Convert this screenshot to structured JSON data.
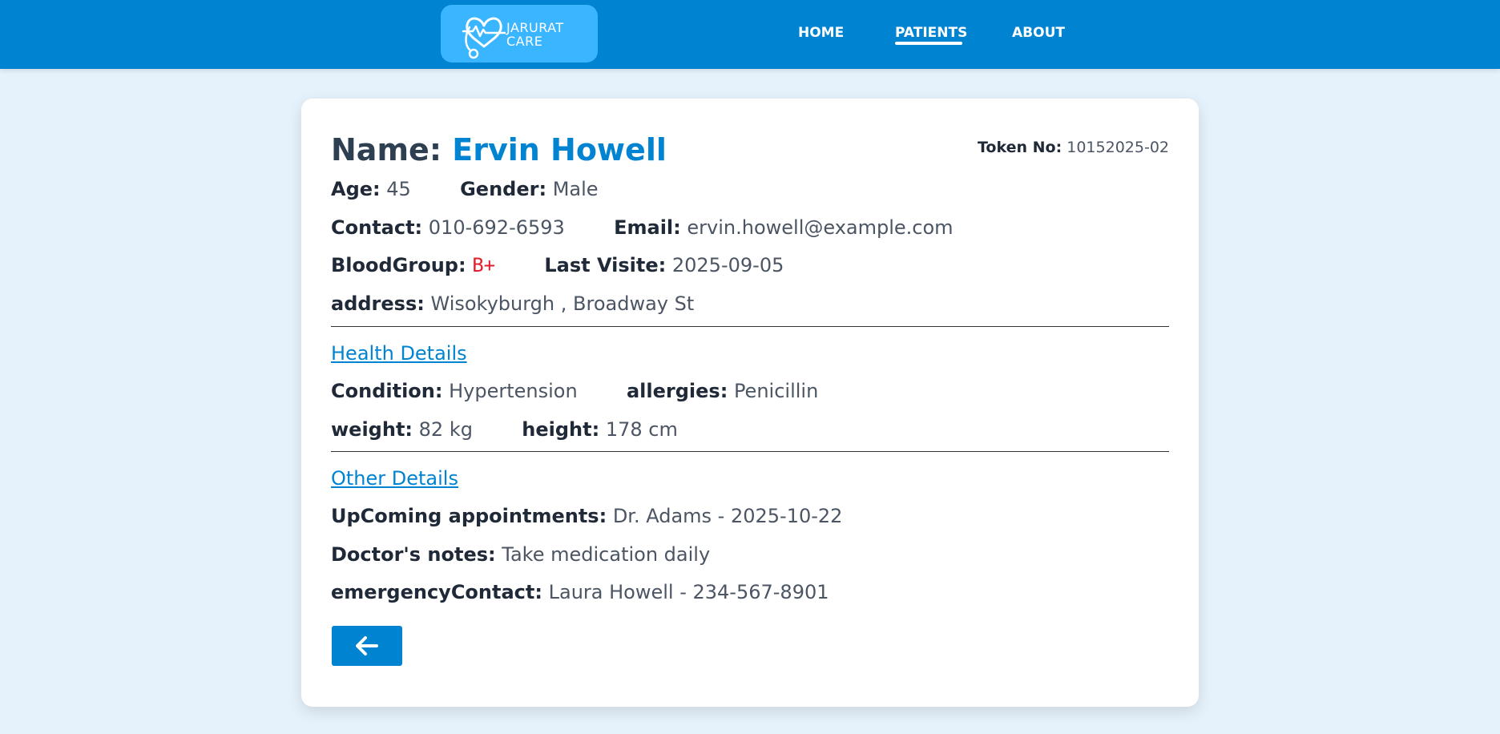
{
  "header": {
    "logo": {
      "line1": "JARURAT",
      "line2": "CARE"
    },
    "nav": [
      {
        "label": "HOME",
        "active": false
      },
      {
        "label": "PATIENTS",
        "active": true
      },
      {
        "label": "ABOUT",
        "active": false
      }
    ]
  },
  "patient": {
    "name_label": "Name:",
    "name": "Ervin Howell",
    "token_label": "Token No:",
    "token": "10152025-02",
    "age_label": "Age:",
    "age": "45",
    "gender_label": "Gender:",
    "gender": "Male",
    "contact_label": "Contact:",
    "contact": "010-692-6593",
    "email_label": "Email:",
    "email": "ervin.howell@example.com",
    "bloodgroup_label": "BloodGroup:",
    "bloodgroup": "B+",
    "last_visit_label": "Last Visite:",
    "last_visit": "2025-09-05",
    "address_label": "address:",
    "address": "Wisokyburgh , Broadway St"
  },
  "health": {
    "section_title": "Health Details",
    "condition_label": "Condition:",
    "condition": "Hypertension",
    "allergies_label": "allergies:",
    "allergies": "Penicillin",
    "weight_label": "weight:",
    "weight": "82 kg",
    "height_label": "height:",
    "height": "178 cm"
  },
  "other": {
    "section_title": "Other Details",
    "appointments_label": "UpComing appointments:",
    "appointments": "Dr. Adams - 2025-10-22",
    "notes_label": "Doctor's notes:",
    "notes": "Take medication daily",
    "emergency_label": "emergencyContact:",
    "emergency": "Laura Howell - 234-567-8901"
  },
  "actions": {
    "back_icon": "arrow-left-icon"
  },
  "colors": {
    "header_bg": "#0083d1",
    "logo_bg": "#3ab5ff",
    "page_bg": "#e6f2fb",
    "accent": "#0083d1",
    "blood": "#e11d2e"
  }
}
